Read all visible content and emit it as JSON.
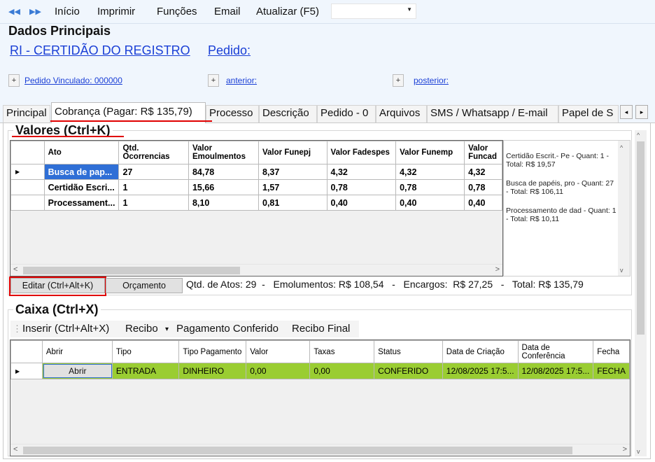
{
  "toolbar": {
    "nav_back_icon": "double-arrow-left-icon",
    "nav_forward_icon": "double-arrow-right-icon",
    "menu": [
      "Início",
      "Imprimir",
      "Funções",
      "Email",
      "Atualizar (F5)"
    ],
    "combo_value": ""
  },
  "header": {
    "title": "Dados Principais",
    "service_link": "RI - CERTIDÃO DO REGISTRO",
    "pedido_link": "Pedido:",
    "plus_label": "+",
    "pedido_vinculado": "Pedido Vinculado: 000000",
    "anterior": "anterior:",
    "posterior": "posterior:"
  },
  "tabs": [
    {
      "label": "Principal"
    },
    {
      "label": "Cobrança (Pagar: R$ 135,79)"
    },
    {
      "label": "Processo"
    },
    {
      "label": "Descrição"
    },
    {
      "label": "Pedido - 0"
    },
    {
      "label": "Arquivos"
    },
    {
      "label": "SMS / Whatsapp / E-mail"
    },
    {
      "label": "Papel de S"
    }
  ],
  "tab_nav": {
    "left": "◂",
    "right": "▸"
  },
  "valores": {
    "title": "Valores (Ctrl+K)",
    "columns": [
      "Ato",
      "Qtd. Ocorrencias",
      "Valor Emoulmentos",
      "Valor Funepj",
      "Valor Fadespes",
      "Valor Funemp",
      "Valor Funcad"
    ],
    "rows": [
      [
        "Busca de pap...",
        "27",
        "84,78",
        "8,37",
        "4,32",
        "4,32",
        "4,32"
      ],
      [
        "Certidão Escri...",
        "1",
        "15,66",
        "1,57",
        "0,78",
        "0,78",
        "0,78"
      ],
      [
        "Processament...",
        "1",
        "8,10",
        "0,81",
        "0,40",
        "0,40",
        "0,40"
      ]
    ],
    "side_notes": [
      "Certidão Escrit.- Pe - Quant: 1 - Total: R$ 19,57",
      "Busca de papéis, pro - Quant: 27 - Total: R$ 106,11",
      "Processamento de dad - Quant: 1 - Total: R$ 10,11"
    ],
    "edit_button": "Editar (Ctrl+Alt+K)",
    "orcamento_button": "Orçamento",
    "summary": "Qtd. de Atos: 29  -   Emolumentos: R$ 108,54   -   Encargos:  R$ 27,25   -   Total: R$ 135,79"
  },
  "caixa": {
    "title": "Caixa (Ctrl+X)",
    "toolbar": {
      "inserir": "Inserir (Ctrl+Alt+X)",
      "recibo": "Recibo",
      "recibo_caret": "▾",
      "pagamento": "Pagamento Conferido",
      "recibo_final": "Recibo Final"
    },
    "columns": [
      "Abrir",
      "Tipo",
      "Tipo Pagamento",
      "Valor",
      "Taxas",
      "Status",
      "Data de Criação",
      "Data de Conferência",
      "Fecha"
    ],
    "rows": [
      [
        "Abrir",
        "ENTRADA",
        "DINHEIRO",
        "0,00",
        "0,00",
        "CONFERIDO",
        "12/08/2025 17:5...",
        "12/08/2025 17:5...",
        "FECHA"
      ]
    ]
  },
  "scroll": {
    "left": "<",
    "right": ">",
    "up": "^",
    "down": "v",
    "row_pointer": "▶"
  },
  "colors": {
    "accent": "#2f6fd6",
    "highlight_green": "#9acd32",
    "annotation_red": "#e00000",
    "link": "#1a3fd6"
  }
}
